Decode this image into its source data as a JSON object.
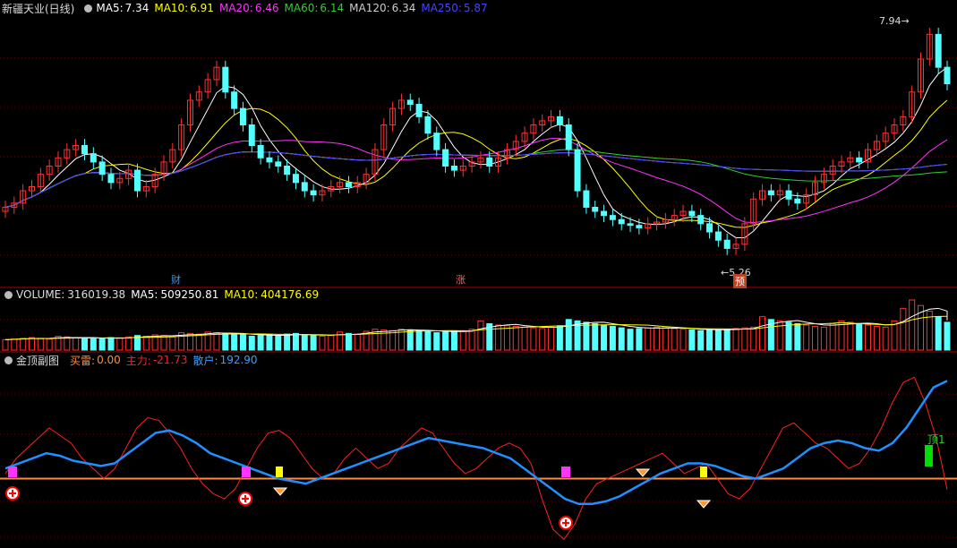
{
  "main": {
    "title": "新疆天业(日线)",
    "ma": [
      {
        "label": "MA5:",
        "value": "7.34",
        "color": "#ffffff"
      },
      {
        "label": "MA10:",
        "value": "6.91",
        "color": "#ffff00"
      },
      {
        "label": "MA20:",
        "value": "6.46",
        "color": "#ff33ff"
      },
      {
        "label": "MA60:",
        "value": "6.14",
        "color": "#33cc33"
      },
      {
        "label": "MA120:",
        "value": "6.34",
        "color": "#cccccc"
      },
      {
        "label": "MA250:",
        "value": "5.87",
        "color": "#4444ff"
      }
    ],
    "high_label": "7.94",
    "low_label": "5.26",
    "event_labels": [
      "财",
      "涨",
      "预"
    ]
  },
  "volume": {
    "label": "VOLUME:",
    "value": "316019.38",
    "ma5_label": "MA5:",
    "ma5_value": "509250.81",
    "ma10_label": "MA10:",
    "ma10_value": "404176.69"
  },
  "indicator": {
    "name": "金顶副图",
    "buy_label": "买雷:",
    "buy_value": "0.00",
    "main_label": "主力:",
    "main_value": "-21.73",
    "retail_label": "散户:",
    "retail_value": "192.90",
    "top_label": "顶1"
  },
  "colors": {
    "up": "#ff3232",
    "down": "#54ffff",
    "panel_line": "#aa0000",
    "main_force": "#ff2020",
    "retail": "#1e90ff",
    "zero_line": "#ff8c3c"
  },
  "chart_data": [
    {
      "type": "candlestick",
      "title": "新疆天业(日线)",
      "ylim": [
        5.0,
        8.1
      ],
      "closes": [
        5.8,
        5.85,
        6.0,
        6.05,
        6.2,
        6.3,
        6.4,
        6.5,
        6.55,
        6.45,
        6.35,
        6.2,
        6.1,
        6.15,
        6.25,
        6.0,
        6.05,
        6.2,
        6.35,
        6.5,
        6.8,
        7.1,
        7.2,
        7.35,
        7.5,
        7.2,
        7.0,
        6.8,
        6.55,
        6.4,
        6.35,
        6.3,
        6.2,
        6.1,
        6.0,
        5.95,
        6.0,
        6.05,
        6.1,
        6.05,
        6.1,
        6.2,
        6.5,
        6.8,
        7.0,
        7.1,
        7.05,
        6.9,
        6.7,
        6.5,
        6.3,
        6.25,
        6.3,
        6.35,
        6.4,
        6.3,
        6.4,
        6.5,
        6.6,
        6.7,
        6.8,
        6.85,
        6.9,
        6.8,
        6.5,
        6.0,
        5.8,
        5.75,
        5.7,
        5.65,
        5.6,
        5.58,
        5.55,
        5.6,
        5.62,
        5.65,
        5.7,
        5.75,
        5.7,
        5.6,
        5.5,
        5.4,
        5.3,
        5.35,
        5.6,
        5.9,
        6.0,
        5.95,
        6.0,
        5.9,
        5.85,
        5.95,
        6.1,
        6.2,
        6.3,
        6.35,
        6.4,
        6.35,
        6.5,
        6.6,
        6.7,
        6.8,
        6.9,
        7.2,
        7.6,
        7.9,
        7.5,
        7.3
      ],
      "ma": {
        "MA5": 7.34,
        "MA10": 6.91,
        "MA20": 6.46,
        "MA60": 6.14,
        "MA120": 6.34,
        "MA250": 5.87
      },
      "annotations": [
        {
          "text": "7.94",
          "type": "high"
        },
        {
          "text": "5.26",
          "type": "low"
        }
      ]
    },
    {
      "type": "bar",
      "title": "VOLUME",
      "values": [
        150,
        160,
        170,
        180,
        170,
        160,
        200,
        190,
        180,
        170,
        160,
        170,
        180,
        175,
        190,
        210,
        200,
        220,
        210,
        190,
        250,
        240,
        230,
        260,
        250,
        240,
        230,
        220,
        200,
        210,
        220,
        210,
        230,
        240,
        220,
        210,
        200,
        210,
        260,
        240,
        230,
        270,
        300,
        290,
        280,
        300,
        290,
        280,
        270,
        250,
        260,
        270,
        280,
        300,
        420,
        380,
        360,
        350,
        340,
        330,
        320,
        310,
        330,
        350,
        440,
        420,
        400,
        380,
        360,
        340,
        320,
        300,
        310,
        320,
        330,
        320,
        310,
        300,
        290,
        280,
        300,
        290,
        300,
        310,
        320,
        330,
        480,
        440,
        420,
        400,
        380,
        360,
        340,
        330,
        380,
        420,
        400,
        380,
        360,
        340,
        330,
        420,
        600,
        720,
        640,
        560,
        480,
        400,
        380,
        316
      ],
      "series": [
        {
          "name": "MA5",
          "value": 509250.81
        },
        {
          "name": "MA10",
          "value": 404176.69
        }
      ]
    },
    {
      "type": "line",
      "title": "金顶副图",
      "series": [
        {
          "name": "主力",
          "last": -21.73,
          "values": [
            10,
            40,
            60,
            80,
            100,
            85,
            70,
            40,
            20,
            0,
            20,
            60,
            100,
            120,
            115,
            90,
            60,
            20,
            -10,
            -30,
            -40,
            -20,
            20,
            60,
            90,
            95,
            80,
            50,
            20,
            0,
            10,
            40,
            60,
            40,
            20,
            30,
            60,
            80,
            100,
            90,
            60,
            30,
            10,
            20,
            40,
            60,
            70,
            60,
            30,
            -40,
            -100,
            -120,
            -90,
            -40,
            -10,
            0,
            10,
            20,
            30,
            40,
            50,
            30,
            10,
            20,
            30,
            0,
            -30,
            -40,
            -20,
            20,
            60,
            100,
            110,
            90,
            70,
            60,
            40,
            20,
            30,
            60,
            100,
            150,
            190,
            200,
            150,
            80,
            -21.73
          ]
        },
        {
          "name": "散户",
          "last": 192.9,
          "values": [
            20,
            30,
            40,
            50,
            45,
            35,
            30,
            25,
            30,
            50,
            70,
            90,
            95,
            85,
            70,
            50,
            40,
            30,
            20,
            10,
            0,
            -5,
            -10,
            0,
            10,
            20,
            30,
            40,
            50,
            60,
            70,
            80,
            75,
            70,
            65,
            60,
            50,
            40,
            20,
            0,
            -20,
            -40,
            -50,
            -50,
            -45,
            -35,
            -20,
            -5,
            10,
            20,
            30,
            30,
            25,
            15,
            5,
            0,
            10,
            20,
            40,
            60,
            70,
            75,
            70,
            60,
            55,
            70,
            100,
            140,
            180,
            192.9
          ]
        }
      ],
      "markers": [
        {
          "text": "顶1"
        }
      ]
    }
  ]
}
